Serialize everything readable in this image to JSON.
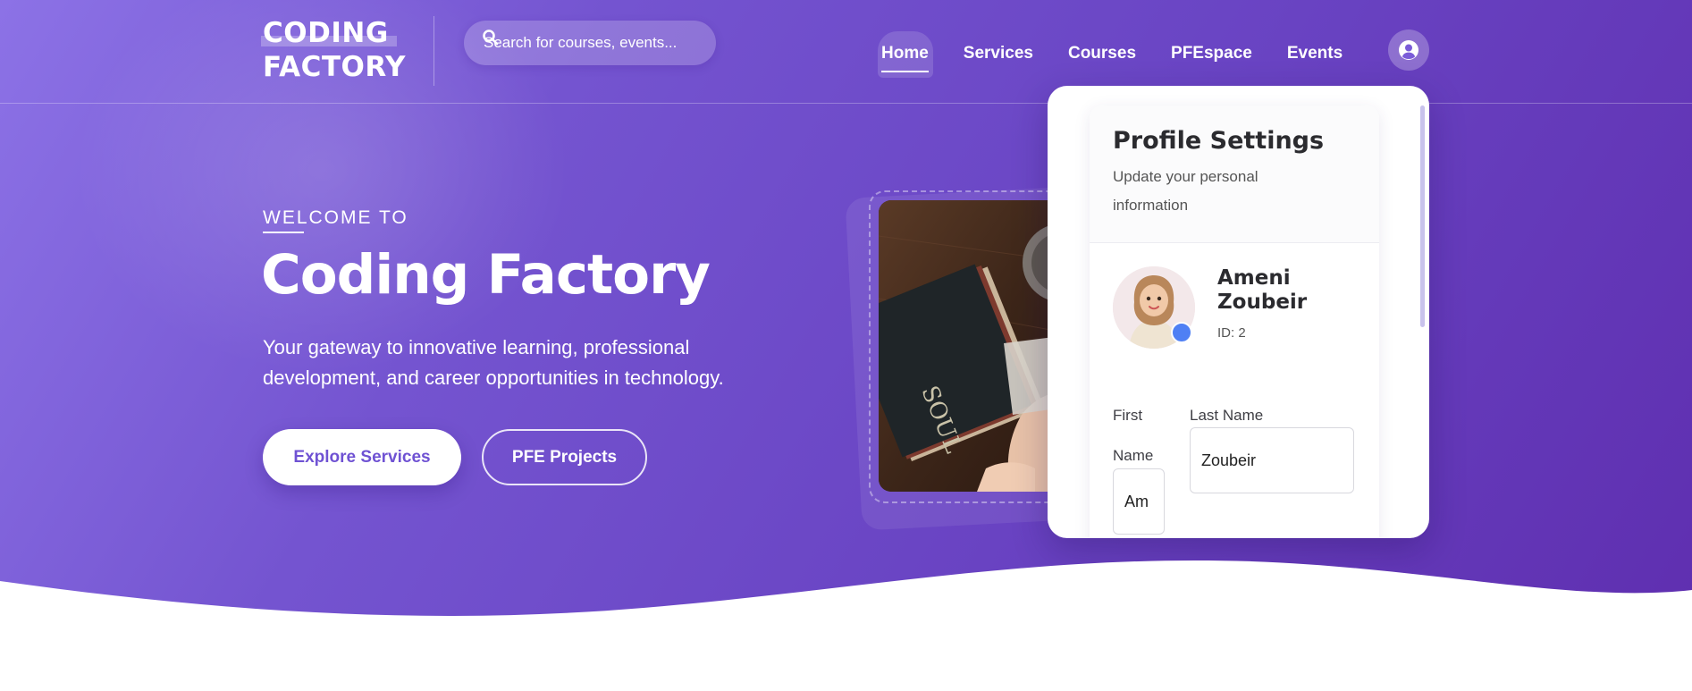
{
  "brand": {
    "logo_line1": "CODING",
    "logo_line2": "FACTORY"
  },
  "search": {
    "placeholder": "Search for courses, events..."
  },
  "nav": {
    "items": [
      {
        "label": "Home",
        "active": true
      },
      {
        "label": "Services",
        "active": false
      },
      {
        "label": "Courses",
        "active": false
      },
      {
        "label": "PFEspace",
        "active": false
      },
      {
        "label": "Events",
        "active": false
      }
    ]
  },
  "hero": {
    "eyebrow": "WELCOME TO",
    "title": "Coding Factory",
    "subtitle": "Your gateway to innovative learning, professional development, and career opportunities in technology.",
    "primary_button": "Explore Services",
    "secondary_button": "PFE Projects"
  },
  "profile_dropdown": {
    "title": "Profile Settings",
    "subtitle": "Update your personal information",
    "user_name": "Ameni Zoubeir",
    "user_id": "ID: 2",
    "first_name_label": "First Name",
    "first_name_value": "Am",
    "last_name_label": "Last Name",
    "last_name_value": "Zoubeir"
  },
  "colors": {
    "hero_gradient_start": "#8c72e6",
    "hero_gradient_end": "#5f2fb0",
    "primary_text_on_white": "#6f52d3",
    "verify_badge": "#4f80f4"
  },
  "icons": [
    "search-icon",
    "user-circle-icon",
    "verified-badge-icon"
  ]
}
